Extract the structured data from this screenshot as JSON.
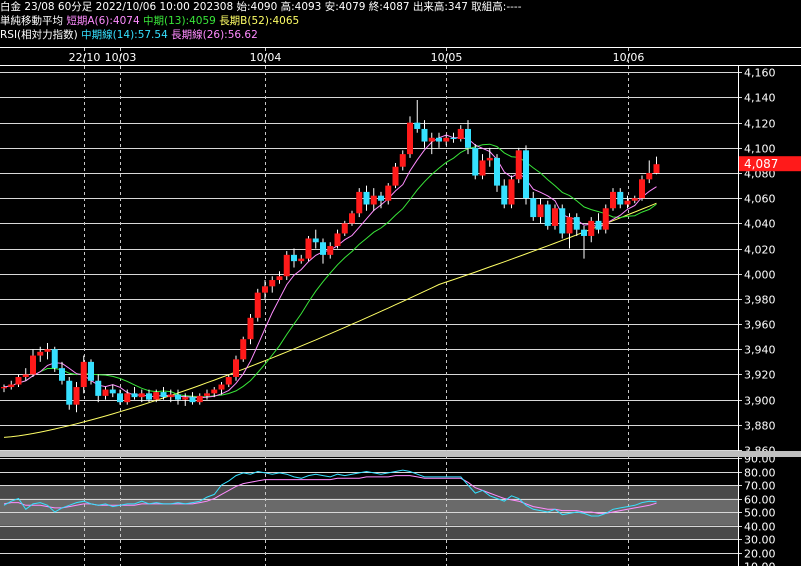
{
  "header": {
    "line1": "白金 23/08 60分足 2022/10/06 10:00 202308 始:4090 高:4093 安:4079 終:4087 出来高:347 取組高:----",
    "ma_title": "単純移動平均",
    "ma_short": "短期A(6):4074",
    "ma_mid": "中期(13):4059",
    "ma_long": "長期B(52):4065",
    "rsi_title": "RSI(相対力指数)",
    "rsi_mid": "中期線(14):57.54",
    "rsi_long": "長期線(26):56.62"
  },
  "colors": {
    "up": "#ff1a1a",
    "down": "#36e0ff",
    "ma_short": "#ff8cff",
    "ma_mid": "#39e639",
    "ma_long": "#ffff66",
    "rsi_mid": "#36e0ff",
    "rsi_long": "#ff8cff",
    "price_tag": "#ff1a1a"
  },
  "chart_data": [
    {
      "type": "candlestick",
      "title": "白金 23/08 60分足",
      "ylim": [
        3860,
        4165
      ],
      "y_ticks": [
        "4,160",
        "4,140",
        "4,120",
        "4,100",
        "4,080",
        "4,060",
        "4,040",
        "4,020",
        "4,000",
        "3,980",
        "3,960",
        "3,940",
        "3,920",
        "3,900",
        "3,880",
        "3,860"
      ],
      "x_labels": [
        {
          "label": "22/10",
          "index": 11
        },
        {
          "label": "10/03",
          "index": 16
        },
        {
          "label": "10/04",
          "index": 36
        },
        {
          "label": "10/05",
          "index": 61
        },
        {
          "label": "10/06",
          "index": 86
        }
      ],
      "last_price": "4,087",
      "candles": [
        [
          3909,
          3912,
          3906,
          3910
        ],
        [
          3910,
          3915,
          3908,
          3912
        ],
        [
          3912,
          3920,
          3910,
          3918
        ],
        [
          3918,
          3925,
          3915,
          3920
        ],
        [
          3920,
          3940,
          3918,
          3935
        ],
        [
          3935,
          3942,
          3930,
          3938
        ],
        [
          3938,
          3945,
          3932,
          3940
        ],
        [
          3940,
          3942,
          3922,
          3925
        ],
        [
          3925,
          3930,
          3912,
          3915
        ],
        [
          3915,
          3918,
          3892,
          3896
        ],
        [
          3896,
          3914,
          3890,
          3910
        ],
        [
          3910,
          3935,
          3905,
          3930
        ],
        [
          3930,
          3932,
          3912,
          3915
        ],
        [
          3915,
          3920,
          3898,
          3903
        ],
        [
          3903,
          3910,
          3900,
          3908
        ],
        [
          3908,
          3912,
          3902,
          3905
        ],
        [
          3905,
          3908,
          3896,
          3898
        ],
        [
          3898,
          3908,
          3896,
          3905
        ],
        [
          3905,
          3910,
          3900,
          3902
        ],
        [
          3902,
          3908,
          3898,
          3905
        ],
        [
          3905,
          3908,
          3898,
          3900
        ],
        [
          3900,
          3908,
          3898,
          3906
        ],
        [
          3906,
          3910,
          3900,
          3902
        ],
        [
          3902,
          3908,
          3898,
          3904
        ],
        [
          3904,
          3908,
          3896,
          3900
        ],
        [
          3900,
          3905,
          3895,
          3902
        ],
        [
          3902,
          3906,
          3896,
          3898
        ],
        [
          3898,
          3905,
          3896,
          3903
        ],
        [
          3903,
          3908,
          3900,
          3905
        ],
        [
          3905,
          3910,
          3902,
          3908
        ],
        [
          3908,
          3914,
          3904,
          3912
        ],
        [
          3912,
          3920,
          3910,
          3918
        ],
        [
          3918,
          3935,
          3915,
          3932
        ],
        [
          3932,
          3950,
          3930,
          3948
        ],
        [
          3948,
          3968,
          3944,
          3965
        ],
        [
          3965,
          3988,
          3962,
          3985
        ],
        [
          3985,
          3995,
          3980,
          3990
        ],
        [
          3990,
          3998,
          3985,
          3995
        ],
        [
          3995,
          4002,
          3992,
          3998
        ],
        [
          3998,
          4018,
          3995,
          4015
        ],
        [
          4015,
          4020,
          4005,
          4010
        ],
        [
          4010,
          4015,
          4008,
          4012
        ],
        [
          4012,
          4030,
          4010,
          4028
        ],
        [
          4028,
          4035,
          4020,
          4025
        ],
        [
          4025,
          4028,
          4008,
          4015
        ],
        [
          4015,
          4025,
          4012,
          4022
        ],
        [
          4022,
          4035,
          4020,
          4032
        ],
        [
          4032,
          4042,
          4030,
          4040
        ],
        [
          4040,
          4050,
          4038,
          4048
        ],
        [
          4048,
          4068,
          4045,
          4065
        ],
        [
          4065,
          4070,
          4050,
          4055
        ],
        [
          4055,
          4068,
          4050,
          4062
        ],
        [
          4062,
          4065,
          4052,
          4058
        ],
        [
          4058,
          4072,
          4055,
          4070
        ],
        [
          4070,
          4088,
          4068,
          4085
        ],
        [
          4085,
          4098,
          4082,
          4095
        ],
        [
          4095,
          4125,
          4092,
          4120
        ],
        [
          4120,
          4138,
          4112,
          4115
        ],
        [
          4115,
          4122,
          4100,
          4105
        ],
        [
          4105,
          4112,
          4095,
          4108
        ],
        [
          4108,
          4112,
          4100,
          4105
        ],
        [
          4105,
          4110,
          4102,
          4108
        ],
        [
          4108,
          4112,
          4104,
          4107
        ],
        [
          4107,
          4118,
          4105,
          4115
        ],
        [
          4115,
          4122,
          4095,
          4100
        ],
        [
          4100,
          4103,
          4075,
          4078
        ],
        [
          4078,
          4095,
          4075,
          4090
        ],
        [
          4090,
          4100,
          4085,
          4092
        ],
        [
          4092,
          4095,
          4065,
          4070
        ],
        [
          4070,
          4075,
          4052,
          4055
        ],
        [
          4055,
          4078,
          4052,
          4075
        ],
        [
          4075,
          4100,
          4072,
          4098
        ],
        [
          4098,
          4102,
          4055,
          4060
        ],
        [
          4060,
          4065,
          4042,
          4045
        ],
        [
          4045,
          4060,
          4040,
          4055
        ],
        [
          4055,
          4058,
          4035,
          4038
        ],
        [
          4038,
          4055,
          4035,
          4052
        ],
        [
          4052,
          4055,
          4028,
          4032
        ],
        [
          4032,
          4048,
          4020,
          4045
        ],
        [
          4045,
          4048,
          4030,
          4035
        ],
        [
          4035,
          4038,
          4012,
          4030
        ],
        [
          4030,
          4045,
          4025,
          4042
        ],
        [
          4042,
          4048,
          4032,
          4035
        ],
        [
          4035,
          4055,
          4032,
          4052
        ],
        [
          4052,
          4068,
          4050,
          4065
        ],
        [
          4065,
          4068,
          4052,
          4055
        ],
        [
          4055,
          4062,
          4052,
          4058
        ],
        [
          4058,
          4062,
          4056,
          4060
        ],
        [
          4060,
          4078,
          4058,
          4075
        ],
        [
          4075,
          4090,
          4072,
          4080
        ],
        [
          4080,
          4093,
          4079,
          4087
        ]
      ]
    },
    {
      "type": "line",
      "title": "RSI(相対力指数)",
      "ylim": [
        10,
        90
      ],
      "y_ticks": [
        "90.00",
        "80.00",
        "70.00",
        "60.00",
        "50.00",
        "40.00",
        "30.00",
        "20.00",
        "10.00"
      ],
      "series": [
        {
          "name": "中期線(14)",
          "values": [
            55,
            58,
            60,
            52,
            56,
            57,
            55,
            50,
            53,
            55,
            57,
            58,
            56,
            55,
            56,
            54,
            55,
            56,
            56,
            58,
            56,
            57,
            56,
            56,
            57,
            56,
            57,
            58,
            61,
            63,
            70,
            73,
            77,
            79,
            78,
            80,
            79,
            78,
            79,
            78,
            76,
            75,
            77,
            78,
            77,
            76,
            78,
            77,
            78,
            79,
            80,
            79,
            78,
            79,
            80,
            81,
            80,
            78,
            76,
            76,
            76,
            76,
            76,
            76,
            70,
            64,
            66,
            62,
            60,
            58,
            62,
            60,
            55,
            52,
            51,
            50,
            52,
            48,
            49,
            50,
            49,
            47,
            47,
            49,
            52,
            53,
            54,
            55,
            57,
            58,
            57.54
          ]
        },
        {
          "name": "長期線(26)",
          "values": [
            56,
            57,
            57,
            55,
            55,
            55,
            54,
            53,
            53,
            54,
            55,
            56,
            56,
            55,
            55,
            55,
            55,
            55,
            55,
            56,
            56,
            56,
            56,
            56,
            56,
            56,
            56,
            57,
            58,
            60,
            63,
            66,
            69,
            71,
            72,
            73,
            74,
            74,
            74,
            74,
            74,
            74,
            74,
            74,
            74,
            74,
            75,
            75,
            75,
            75,
            76,
            76,
            76,
            76,
            77,
            77,
            77,
            76,
            75,
            75,
            75,
            75,
            75,
            75,
            72,
            68,
            66,
            64,
            62,
            60,
            59,
            58,
            56,
            54,
            53,
            52,
            52,
            51,
            51,
            51,
            50,
            50,
            49,
            49,
            50,
            51,
            52,
            53,
            54,
            55,
            56.62
          ]
        }
      ]
    }
  ]
}
